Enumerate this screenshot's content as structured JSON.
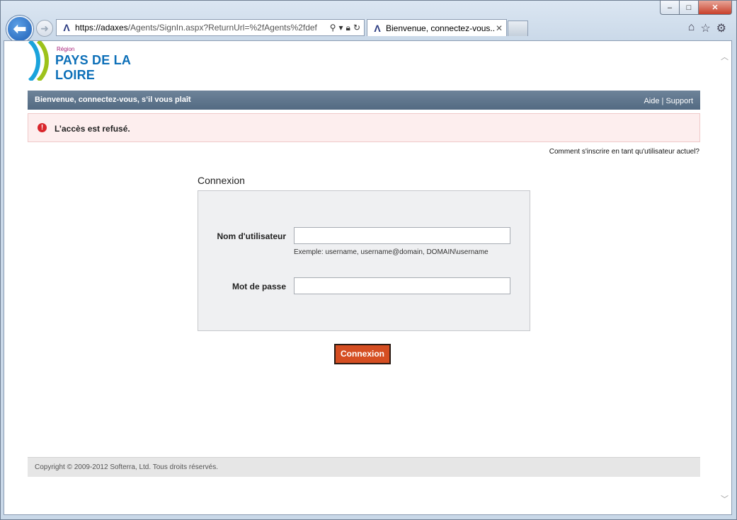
{
  "browser": {
    "url_host": "https://adaxes",
    "url_path": "/Agents/SignIn.aspx?ReturnUrl=%2fAgents%2fdef",
    "tab_title": "Bienvenue, connectez-vous...",
    "window_controls": {
      "minimize": "–",
      "maximize": "□",
      "close": "✕"
    }
  },
  "logo": {
    "region": "Région",
    "name": "PAYS DE LA LOIRE"
  },
  "header": {
    "title": "Bienvenue, connectez-vous, s’il vous plaît",
    "help": "Aide",
    "separator": "|",
    "support": "Support"
  },
  "alert": {
    "icon": "!",
    "message": "L’accès est refusé."
  },
  "register_link": "Comment s'inscrire en tant qu'utilisateur actuel?",
  "form": {
    "title": "Connexion",
    "username_label": "Nom d'utilisateur",
    "username_value": "",
    "username_hint": "Exemple: username, username@domain, DOMAIN\\username",
    "password_label": "Mot de passe",
    "password_value": "",
    "submit_label": "Connexion"
  },
  "footer": {
    "copyright": "Copyright © 2009-2012 Softerra, Ltd. Tous droits réservés."
  },
  "colors": {
    "submit_bg": "#d54e22",
    "header_bg": "#5f7489",
    "alert_bg": "#fdeeee",
    "logo_blue": "#0c6fb8",
    "logo_green": "#9dc21b"
  }
}
